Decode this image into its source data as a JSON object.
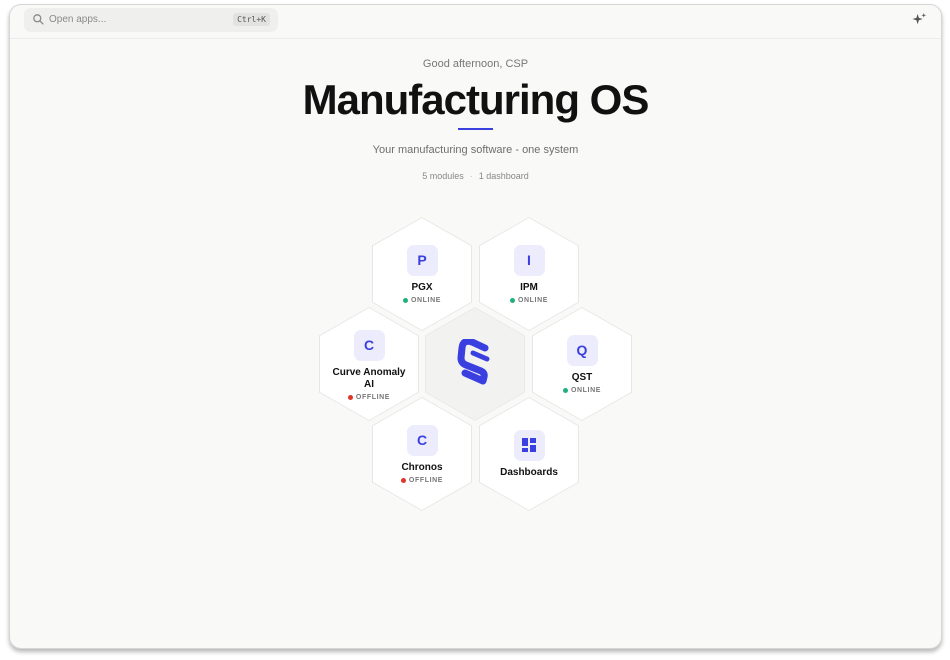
{
  "search": {
    "placeholder": "Open apps...",
    "shortcut": "Ctrl+K"
  },
  "hero": {
    "greeting": "Good afternoon, CSP",
    "title": "Manufacturing OS",
    "subtitle": "Your manufacturing software - one system",
    "stats": {
      "modules": "5 modules",
      "separator": "·",
      "dashboards": "1 dashboard"
    }
  },
  "colors": {
    "accent": "#3a3fe0",
    "online": "#22b07a",
    "offline": "#e0352b"
  },
  "modules": [
    {
      "letter": "P",
      "name": "PGX",
      "status": "ONLINE"
    },
    {
      "letter": "I",
      "name": "IPM",
      "status": "ONLINE"
    },
    {
      "letter": "C",
      "name": "Curve Anomaly AI",
      "status": "OFFLINE"
    },
    {
      "letter": "Q",
      "name": "QST",
      "status": "ONLINE"
    },
    {
      "letter": "C",
      "name": "Chronos",
      "status": "OFFLINE"
    }
  ],
  "dashboards": {
    "label": "Dashboards",
    "icon": "grid-icon"
  },
  "center": {
    "icon": "app-logo-icon"
  }
}
